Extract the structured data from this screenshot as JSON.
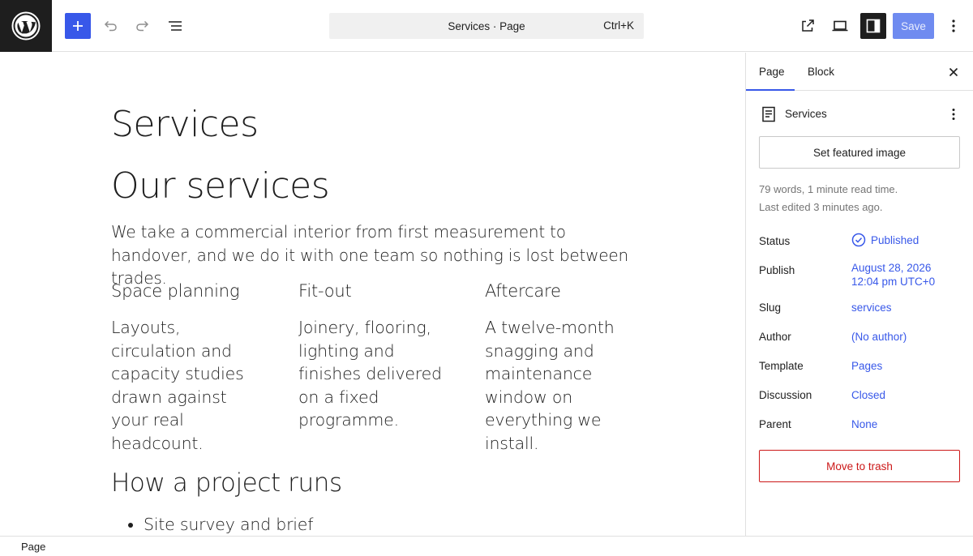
{
  "toolbar": {
    "logo_icon": "wordpress-logo-icon",
    "add_icon": "plus-icon",
    "undo_icon": "undo-icon",
    "redo_icon": "redo-icon",
    "list_view_icon": "list-view-icon",
    "command": {
      "title": "Services · Page",
      "shortcut": "Ctrl+K"
    },
    "view_icon": "external-link-icon",
    "device_icon": "desktop-preview-icon",
    "settings_icon": "sidebar-settings-icon",
    "save_label": "Save",
    "more_icon": "more-vertical-icon"
  },
  "canvas": {
    "page_title": "Services",
    "heading": "Our services",
    "intro": "We take a commercial interior from first measurement to handover, and we do it with one team so nothing is lost between trades.",
    "columns": [
      {
        "title": "Space planning",
        "body": "Layouts, circulation and capacity studies drawn against your real headcount."
      },
      {
        "title": "Fit-out",
        "body": "Joinery, flooring, lighting and finishes delivered on a fixed programme."
      },
      {
        "title": "Aftercare",
        "body": "A twelve-month snagging and maintenance window on everything we install."
      }
    ],
    "process_heading": "How a project runs",
    "steps": [
      "Site survey and brief"
    ]
  },
  "sidebar": {
    "tabs": {
      "page": "Page",
      "block": "Block"
    },
    "close_icon": "close-icon",
    "doc_icon": "page-icon",
    "doc_title": "Services",
    "doc_more_icon": "more-vertical-icon",
    "featured_image_label": "Set featured image",
    "words": "79 words, 1 minute read time.",
    "last_edited": "Last edited 3 minutes ago.",
    "rows": {
      "status": {
        "label": "Status",
        "value": "Published",
        "icon": "published-check-icon"
      },
      "publish": {
        "label": "Publish",
        "value_line1": "August 28, 2026",
        "value_line2": "12:04 pm UTC+0"
      },
      "slug": {
        "label": "Slug",
        "value": "services"
      },
      "author": {
        "label": "Author",
        "value": "(No author)"
      },
      "template": {
        "label": "Template",
        "value": "Pages"
      },
      "discussion": {
        "label": "Discussion",
        "value": "Closed"
      },
      "parent": {
        "label": "Parent",
        "value": "None"
      }
    },
    "trash_label": "Move to trash"
  },
  "footer": {
    "breadcrumb": "Page"
  },
  "colors": {
    "accent": "#3858e9",
    "save_disabled": "#6f8bf0",
    "danger": "#cc1818",
    "dark": "#1e1e1e",
    "muted": "#757575"
  }
}
